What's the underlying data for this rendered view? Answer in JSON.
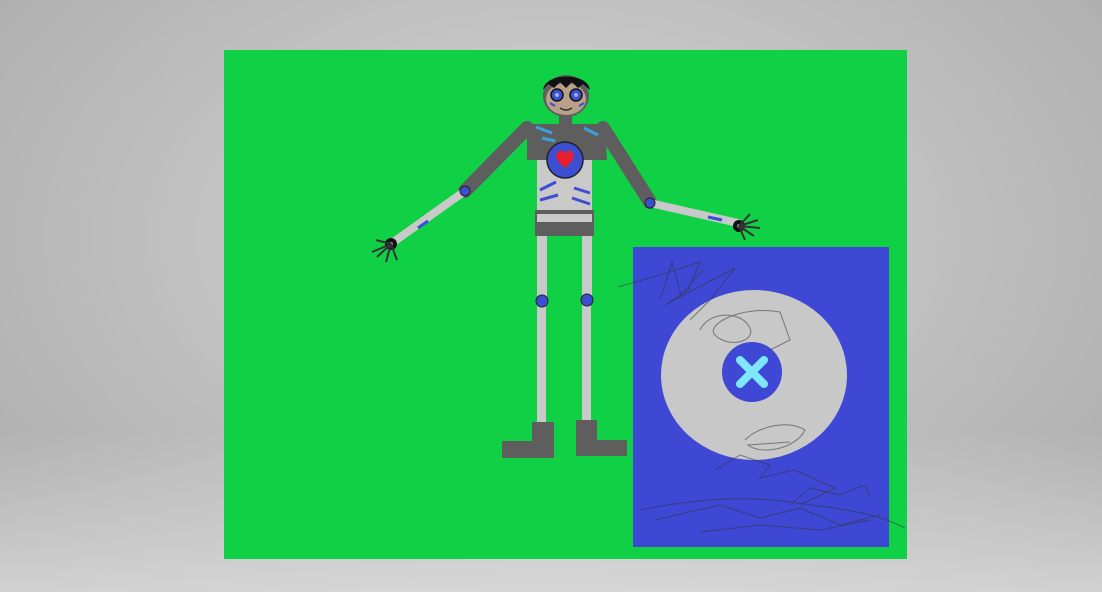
{
  "colors": {
    "background_gray": "#c2c2c2",
    "green_screen": "#10d146",
    "blue_panel": "#3e48d4",
    "disc_gray": "#c8c8c8",
    "center_blue": "#3e48d4",
    "x_mark": "#7fe6ff",
    "robot_gray": "#5e5e5e",
    "robot_light": "#c9c9c9",
    "robot_joint": "#3b4fd0",
    "heart_red": "#e8202e",
    "scribble": "#333333"
  },
  "icons": {
    "close_mark": "x-mark-icon",
    "heart": "heart-icon"
  }
}
